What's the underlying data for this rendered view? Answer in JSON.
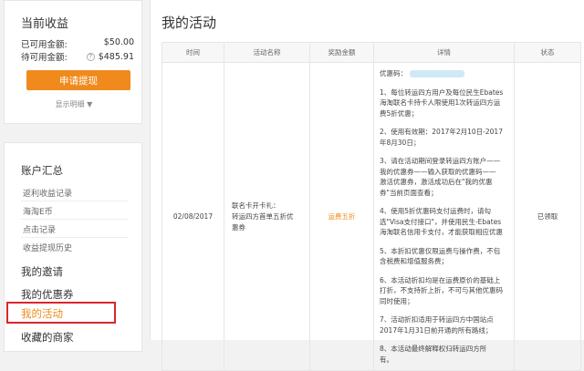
{
  "earnings": {
    "title": "当前收益",
    "available_label": "已可用金额:",
    "available_value": "$50.00",
    "pending_label": "待可用金额:",
    "pending_value": "$485.91",
    "withdraw_button": "申请提现",
    "show_detail": "显示明细 ▼"
  },
  "menu": {
    "account_summary": "账户汇总",
    "sub_items": [
      "返利收益记录",
      "海淘E币",
      "点击记录",
      "收益提现历史"
    ],
    "my_invites": "我的邀请",
    "my_coupons": "我的优惠券",
    "my_activities": "我的活动",
    "favorite_stores": "收藏的商家"
  },
  "main": {
    "title": "我的活动",
    "columns": [
      "时间",
      "活动名称",
      "奖励金额",
      "详情",
      "状态"
    ],
    "row": {
      "time": "02/08/2017",
      "name_lines": [
        "联名卡开卡礼：",
        "转运四方首单五折优",
        "惠券"
      ],
      "amount": "运费五折",
      "coupon_label": "优惠码：",
      "detail_lines": [
        "1、每位转运四方用户及每位民生Ebates",
        "海淘联名卡持卡人限使用1次转运四方运",
        "费5折优惠；",
        "2、使用有效期：2017年2月10日-2017",
        "年8月30日；",
        "3、请在活动期间登录转运四方账户——",
        "我的优惠券——输入获取的优惠码——",
        "激活优惠券，激活成功后在\"我的优惠",
        "券\"当前页面查看；",
        "4、使用5折优惠码支付运费时，请勾",
        "选\"Visa支付接口\"，并使用民生-Ebates",
        "海淘联名信用卡支付，才能获取相应优惠",
        "5、本折扣优惠仅限运费与操作费，不包",
        "含税费和增值服务费；",
        "6、本活动折扣均是在运费原价的基础上",
        "打折，不支持折上折，不可与其他优惠码",
        "同时使用；",
        "7、活动折扣适用于转运四方中国站点",
        "2017年1月31日前开通的所有路线；",
        "8、本活动最终解释权归转运四方所",
        "有。"
      ],
      "status": "已领取"
    }
  }
}
